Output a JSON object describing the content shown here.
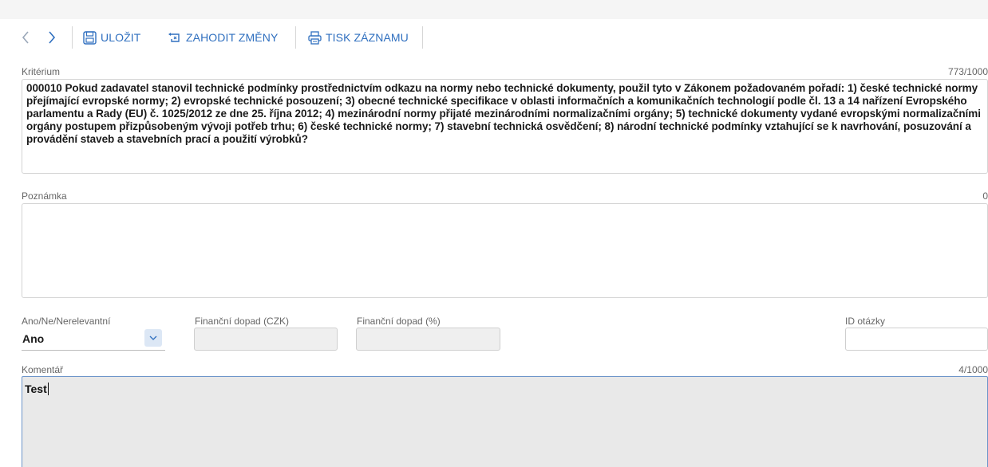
{
  "toolbar": {
    "back_label": "<",
    "forward_label": ">",
    "save_label": "ULOŽIT",
    "discard_label": "ZAHODIT ZMĚNY",
    "print_label": "TISK ZÁZNAMU"
  },
  "criterion": {
    "label": "Kritérium",
    "counter": "773/1000",
    "text": "000010 Pokud zadavatel stanovil technické podmínky prostřednictvím odkazu na normy nebo technické dokumenty, použil tyto v Zákonem požadovaném pořadí: 1) české technické normy přejímající evropské normy; 2) evropské technické posouzení; 3) obecné technické specifikace v oblasti informačních a komunikačních technologií podle čl. 13 a 14 nařízení Evropského parlamentu a Rady (EU) č. 1025/2012 ze dne 25. října 2012; 4) mezinárodní normy přijaté mezinárodními normalizačními orgány; 5) technické dokumenty vydané evropskými normalizačními orgány postupem přizpůsobeným vývoji potřeb trhu; 6) české technické normy; 7) stavební technická osvědčení; 8) národní technické podmínky vztahující se k navrhování, posuzování a provádění staveb a stavebních prací a použití výrobků?"
  },
  "note": {
    "label": "Poznámka",
    "counter": "0",
    "value": ""
  },
  "answer": {
    "label": "Ano/Ne/Nerelevantní",
    "value": "Ano"
  },
  "financial_czk": {
    "label": "Finanční dopad (CZK)",
    "value": ""
  },
  "financial_pct": {
    "label": "Finanční dopad (%)",
    "value": ""
  },
  "question_id": {
    "label": "ID otázky",
    "value": ""
  },
  "comment": {
    "label": "Komentář",
    "counter": "4/1000",
    "value": "Test"
  },
  "colors": {
    "accent": "#2f6fbf",
    "border": "#d4d4d4",
    "disabled": "#efefef",
    "focus": "#6c94c9"
  }
}
